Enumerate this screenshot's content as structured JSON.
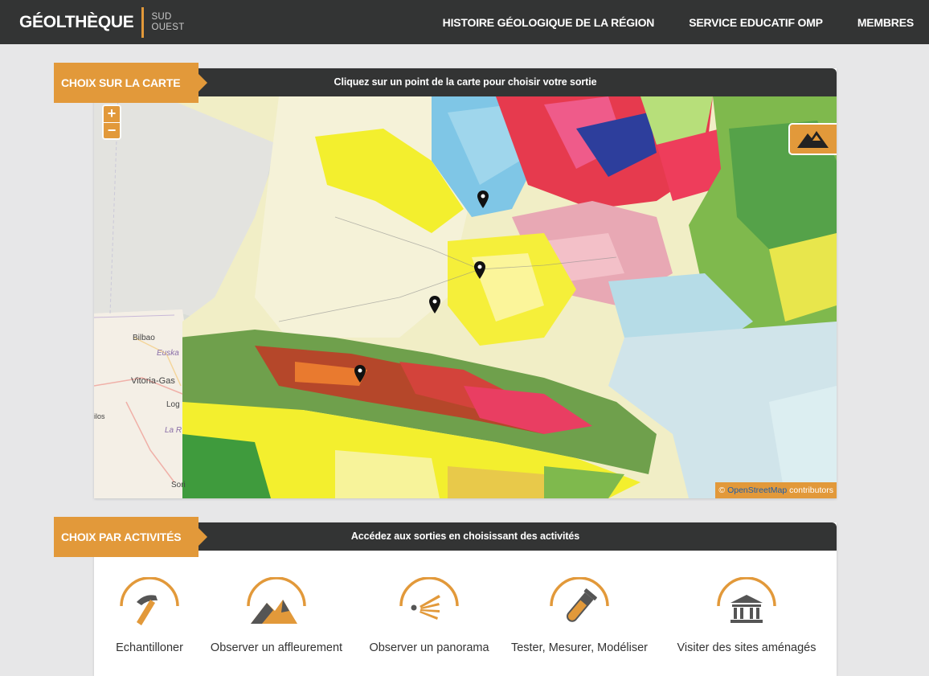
{
  "brand": {
    "name": "GÉOLTHÈQUE",
    "sub_line1": "SUD",
    "sub_line2": "OUEST"
  },
  "nav": [
    {
      "label": "HISTOIRE GÉOLOGIQUE DE LA RÉGION"
    },
    {
      "label": "SERVICE EDUCATIF OMP"
    },
    {
      "label": "MEMBRES"
    }
  ],
  "map_section": {
    "tag": "CHOIX SUR LA CARTE",
    "caption": "Cliquez sur un point de la carte pour choisir votre sortie",
    "zoom_in": "+",
    "zoom_out": "−",
    "layer_icon": "mountain-icon",
    "attribution": {
      "prefix": "© ",
      "link": "OpenStreetMap",
      "suffix": " contributors"
    },
    "places": [
      "Bilbao",
      "Euska",
      "Vitoria-Gas",
      "Log",
      "La R",
      "Sori",
      "ilos"
    ],
    "marker_count": 4
  },
  "activities_section": {
    "tag": "CHOIX PAR ACTIVITÉS",
    "caption": "Accédez aux sorties en choisissant des activités",
    "items": [
      {
        "label": "Echantilloner",
        "icon": "hammer-icon"
      },
      {
        "label": "Observer un affleurement",
        "icon": "outcrop-icon"
      },
      {
        "label": "Observer un panorama",
        "icon": "panorama-icon"
      },
      {
        "label": "Tester, Mesurer, Modéliser",
        "icon": "test-tube-icon"
      },
      {
        "label": "Visiter des sites aménagés",
        "icon": "museum-icon"
      }
    ]
  },
  "colors": {
    "accent": "#e2993a",
    "navbar": "#333434",
    "page_bg": "#e7e7e8",
    "icon_grey": "#6b6b6b"
  }
}
